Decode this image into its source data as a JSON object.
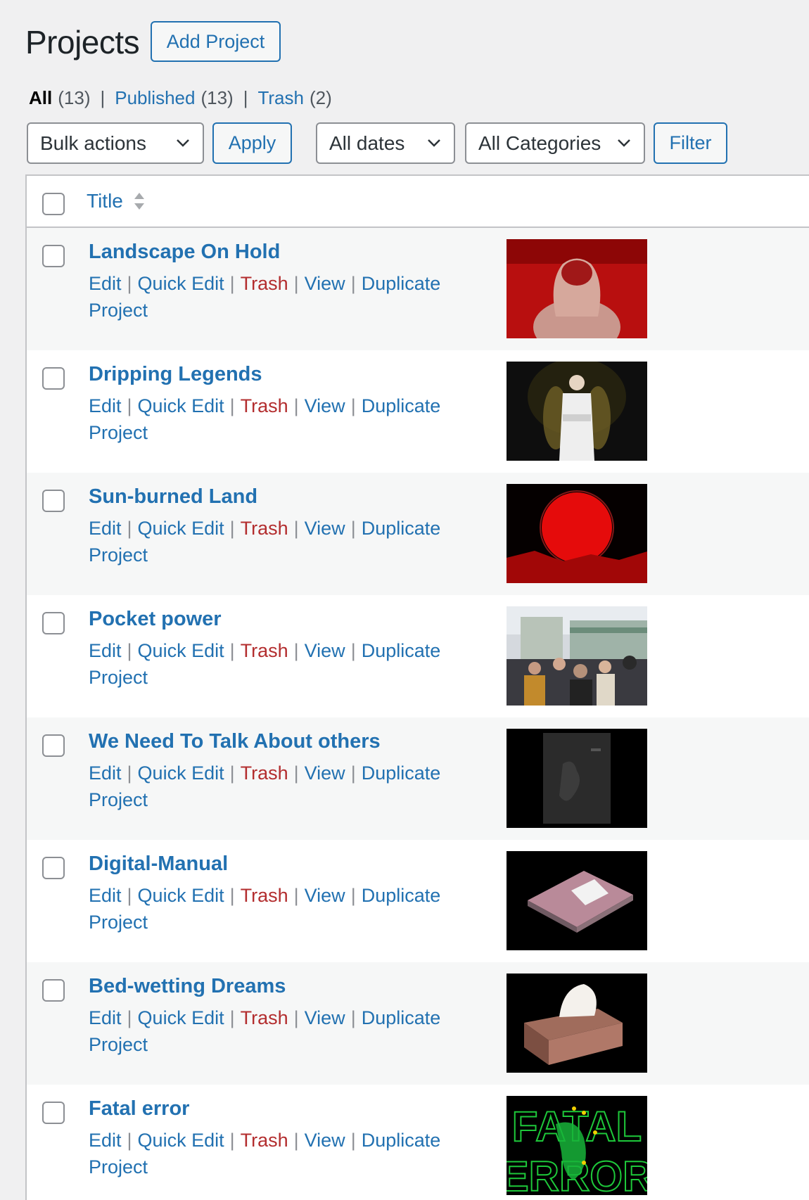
{
  "header": {
    "title": "Projects",
    "add_label": "Add Project"
  },
  "views": {
    "all": {
      "label": "All",
      "count": "(13)"
    },
    "published": {
      "label": "Published",
      "count": "(13)"
    },
    "trash": {
      "label": "Trash",
      "count": "(2)"
    },
    "separator": "|"
  },
  "tablenav": {
    "bulk_actions": "Bulk actions",
    "apply": "Apply",
    "dates": "All dates",
    "categories": "All Categories",
    "filter": "Filter"
  },
  "table": {
    "title_column": "Title"
  },
  "row_actions": {
    "edit": "Edit",
    "quick_edit": "Quick Edit",
    "trash": "Trash",
    "view": "View",
    "duplicate": "Duplicate",
    "project": "Project",
    "separator": "|"
  },
  "rows": [
    {
      "title": "Landscape On Hold",
      "thumbnail": "figure-on-red-thumbnail"
    },
    {
      "title": "Dripping Legends",
      "thumbnail": "figure-in-white-thumbnail"
    },
    {
      "title": "Sun-burned Land",
      "thumbnail": "red-sun-thumbnail"
    },
    {
      "title": "Pocket power",
      "thumbnail": "crowd-photo-thumbnail"
    },
    {
      "title": "We Need To Talk About others",
      "thumbnail": "dark-book-thumbnail"
    },
    {
      "title": "Digital-Manual",
      "thumbnail": "manual-box-thumbnail"
    },
    {
      "title": "Bed-wetting Dreams",
      "thumbnail": "tissue-box-thumbnail"
    },
    {
      "title": "Fatal error",
      "thumbnail": "fatal-error-thumbnail"
    }
  ],
  "thumbnail_text": {
    "fatal_line1": "FATAL",
    "fatal_line2": "ERROR"
  },
  "colors": {
    "link": "#2271b1",
    "trash": "#b32d2e",
    "background": "#f0f0f1"
  }
}
